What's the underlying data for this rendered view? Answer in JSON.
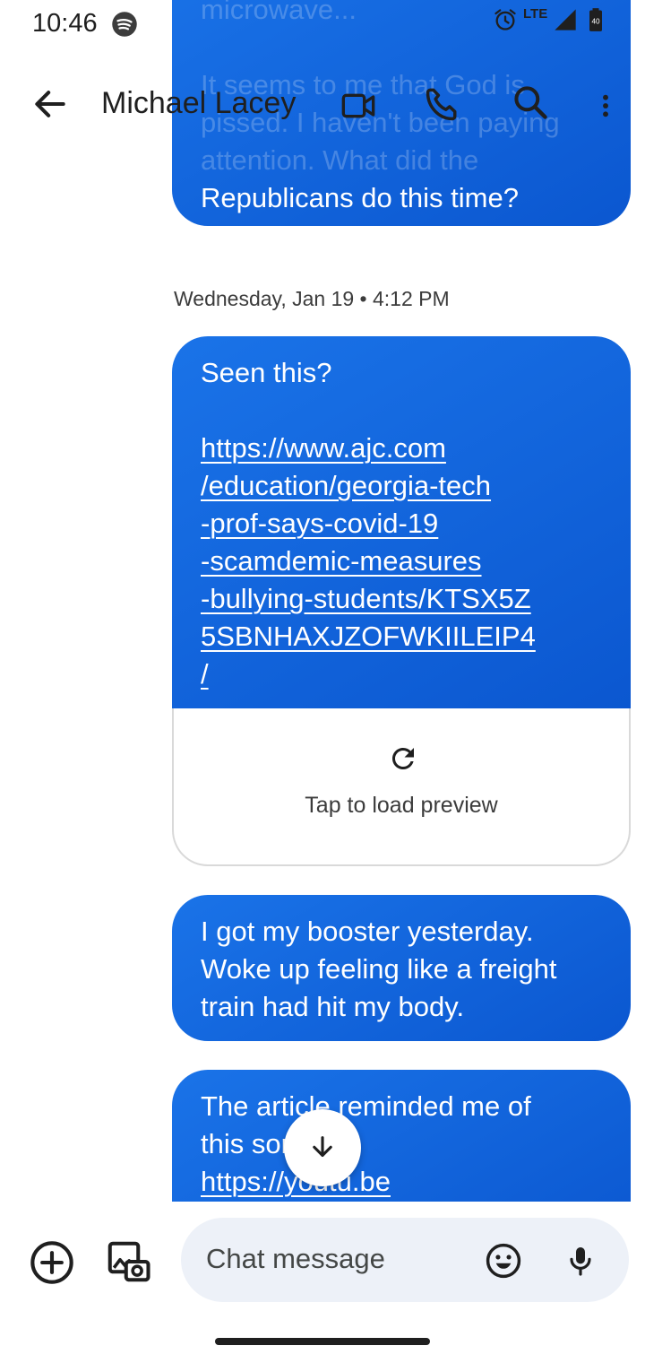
{
  "status_bar": {
    "time": "10:46",
    "network": "LTE",
    "battery": "40",
    "icons": [
      "spotify-icon",
      "alarm-icon",
      "signal-icon",
      "battery-icon"
    ]
  },
  "header": {
    "contact_name": "Michael Lacey",
    "icons": [
      "back-arrow-icon",
      "video-call-icon",
      "phone-icon",
      "search-icon",
      "more-vert-icon"
    ]
  },
  "messages": {
    "top_partial": {
      "faded_lines": [
        "microwave...",
        "",
        "It seems to me that God is",
        "pissed. I haven't been paying",
        "attention. What did the"
      ],
      "visible_line": "Republicans do this time?"
    },
    "date_separator": "Wednesday, Jan 19 • 4:12 PM",
    "link_message": {
      "intro": "Seen this?",
      "link_lines": [
        "https://www.ajc.com",
        "/education/georgia-tech",
        "-prof-says-covid-19",
        "-scamdemic-measures",
        "-bullying-students/KTSX5Z",
        "5SBNHAXJZOFWKIILEIP4",
        "/"
      ],
      "preview_label": "Tap to load preview"
    },
    "booster": {
      "lines": [
        "I got my booster yesterday.",
        "Woke up feeling like a freight",
        "train had hit my body."
      ]
    },
    "article": {
      "lines": [
        "The article reminded me of",
        "this song:",
        "https://youtu.be"
      ]
    }
  },
  "compose": {
    "placeholder": "Chat message"
  },
  "colors": {
    "bubble": "#1a73e8",
    "bubble_dark": "#0b57d0",
    "compose_bg": "#edf1f8",
    "text": "#1f1f1f"
  }
}
